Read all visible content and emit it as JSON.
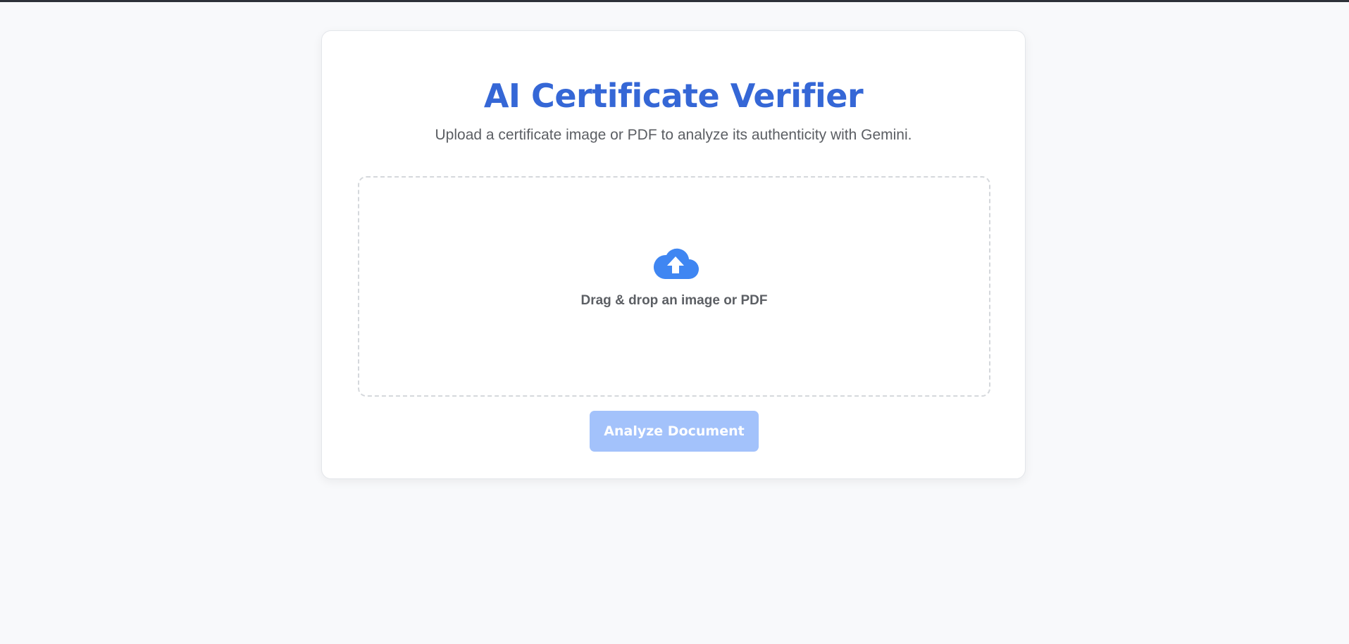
{
  "page": {
    "title": "AI Certificate Verifier",
    "subtitle": "Upload a certificate image or PDF to analyze its authenticity with Gemini."
  },
  "upload": {
    "icon": "cloud-upload-icon",
    "label": "Drag & drop an image or PDF"
  },
  "actions": {
    "analyze_label": "Analyze Document",
    "analyze_disabled": true
  },
  "colors": {
    "accent": "#3567d6",
    "icon_blue": "#3f86f2",
    "button_disabled": "#a3c2fb",
    "background": "#f8f9fb",
    "top_strip": "#2d3138"
  }
}
